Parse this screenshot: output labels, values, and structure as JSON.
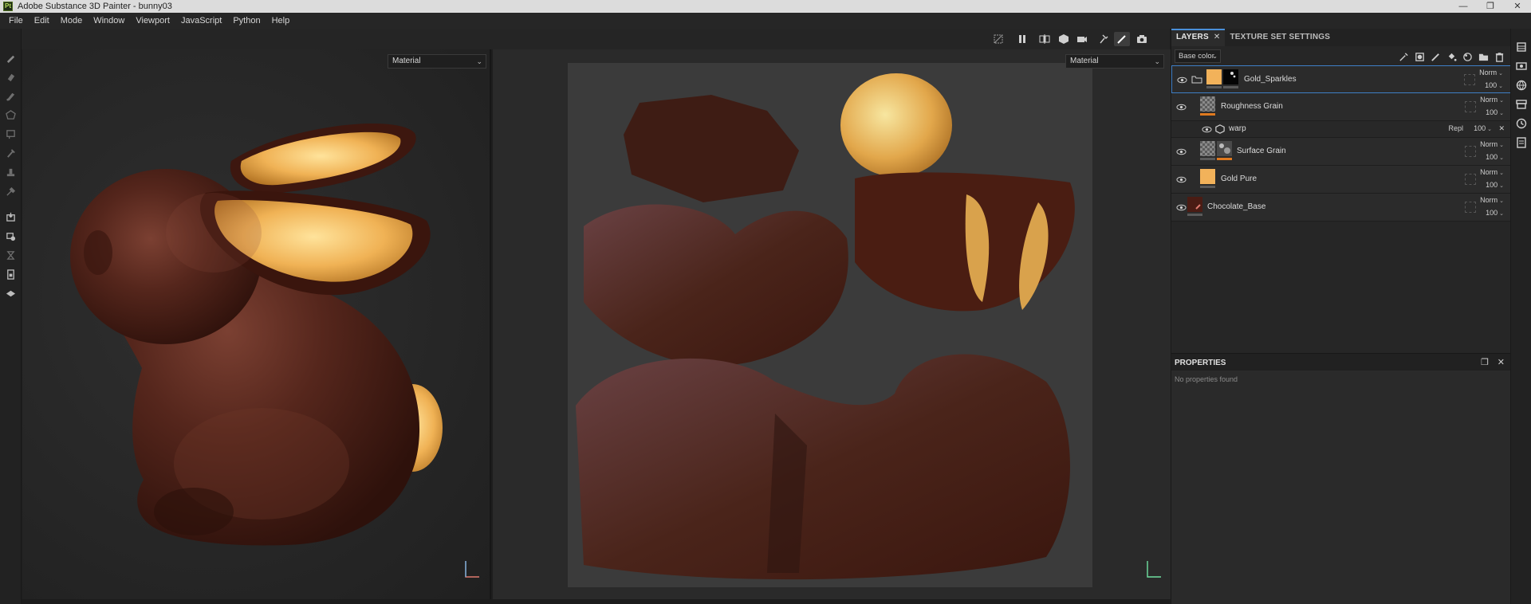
{
  "window": {
    "title": "Adobe Substance 3D Painter - bunny03",
    "logo_text": "Pt",
    "minimize": "—",
    "maximize": "❐",
    "close": "✕"
  },
  "menu": [
    "File",
    "Edit",
    "Mode",
    "Window",
    "Viewport",
    "JavaScript",
    "Python",
    "Help"
  ],
  "viewport_3d": {
    "mode_select": "Material"
  },
  "viewport_2d": {
    "mode_select": "Material"
  },
  "layers_panel": {
    "tabs": [
      {
        "label": "LAYERS",
        "close": "✕"
      },
      {
        "label": "TEXTURE SET SETTINGS"
      }
    ],
    "channel": "Base color",
    "layers": [
      {
        "name": "Gold_Sparkles",
        "blend": "Norm",
        "opacity": "100",
        "type": "folder",
        "color": "#f2b25a"
      },
      {
        "name": "Roughness Grain",
        "blend": "Norm",
        "opacity": "100",
        "type": "fill"
      },
      {
        "name": "warp",
        "blend": "Repl",
        "opacity": "100",
        "type": "filter"
      },
      {
        "name": "Surface Grain",
        "blend": "Norm",
        "opacity": "100",
        "type": "fill"
      },
      {
        "name": "Gold Pure",
        "blend": "Norm",
        "opacity": "100",
        "type": "fill",
        "color": "#f2b25a"
      },
      {
        "name": "Chocolate_Base",
        "blend": "Norm",
        "opacity": "100",
        "type": "fill",
        "color": "#4a1c14"
      }
    ]
  },
  "properties_panel": {
    "title": "PROPERTIES",
    "empty_text": "No properties found"
  },
  "colors": {
    "accent": "#3f7fc6",
    "gold": "#f2b25a",
    "chocolate": "#4a1c14",
    "orange_bar": "#e07a1f"
  }
}
